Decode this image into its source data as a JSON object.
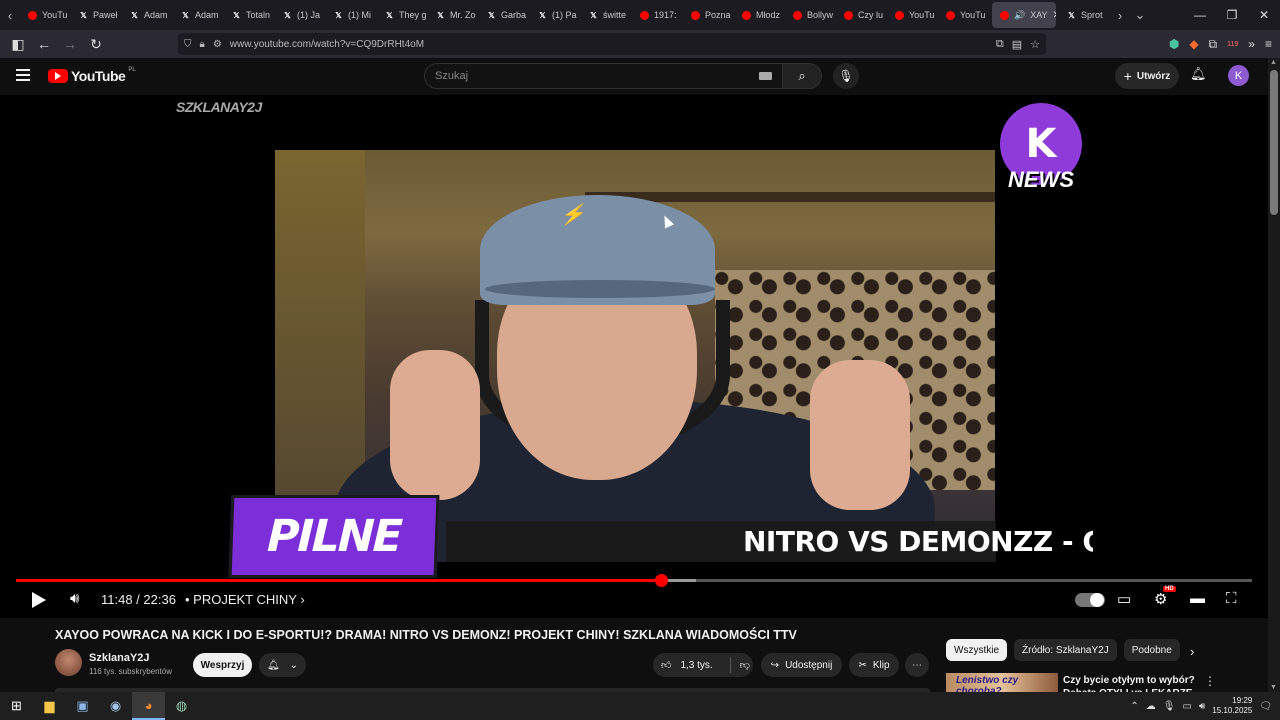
{
  "browser": {
    "tabs": [
      {
        "label": "YouTu",
        "icon": "youtube-icon"
      },
      {
        "label": "Paweł",
        "icon": "x-icon"
      },
      {
        "label": "Adam",
        "icon": "x-icon"
      },
      {
        "label": "Adam",
        "icon": "x-icon"
      },
      {
        "label": "Totaln",
        "icon": "x-icon"
      },
      {
        "label": "(1) Ja",
        "icon": "x-icon"
      },
      {
        "label": "(1) Mi",
        "icon": "x-icon"
      },
      {
        "label": "They g",
        "icon": "x-icon"
      },
      {
        "label": "Mr. Zo",
        "icon": "x-icon"
      },
      {
        "label": "Garba",
        "icon": "x-icon"
      },
      {
        "label": "(1) Pa",
        "icon": "x-icon"
      },
      {
        "label": "świtte",
        "icon": "x-icon"
      },
      {
        "label": "1917:",
        "icon": "youtube-icon"
      },
      {
        "label": "Pozna",
        "icon": "youtube-icon"
      },
      {
        "label": "Młodz",
        "icon": "youtube-icon"
      },
      {
        "label": "Bollyw",
        "icon": "youtube-icon"
      },
      {
        "label": "Czy lu",
        "icon": "youtube-icon"
      },
      {
        "label": "YouTu",
        "icon": "youtube-icon"
      },
      {
        "label": "YouTu",
        "icon": "youtube-icon"
      }
    ],
    "active_tab": {
      "label": "XAY",
      "icon": "youtube-icon",
      "audio_icon": "speaker-icon"
    },
    "trailing_tab": {
      "label": "Sprot",
      "icon": "x-icon"
    },
    "url": "www.youtube.com/watch?v=CQ9DrRHt4oM",
    "extension_badge": "119"
  },
  "youtube": {
    "logo_text": "YouTube",
    "country_code": "PL",
    "search_placeholder": "Szukaj",
    "create_label": "Utwórz",
    "avatar_letter": "K"
  },
  "player": {
    "channel_watermark": "SZKLANAY2J",
    "brand_badge": "NEWS",
    "banner_label": "PILNE",
    "ticker_text": "NITRO VS DEMONZZ - OSTR",
    "current_time": "11:48",
    "duration": "22:36",
    "time_display": "11:48 / 22:36",
    "chapter": "• PROJEKT CHINY",
    "progress_fraction": 0.522,
    "buffered_fraction": 0.55,
    "quality_badge": "HD"
  },
  "video": {
    "title": "XAYOO POWRACA NA KICK I DO E-SPORTU!? DRAMA! NITRO VS DEMONZ! PROJEKT CHINY! SZKLANA WIADOMOŚCI TTV",
    "channel_name": "SzklanaY2J",
    "subscribers": "116 tys. subskrybentów",
    "support_label": "Wesprzyj",
    "like_count": "1,3 tys.",
    "share_label": "Udostępnij",
    "clip_label": "Klip"
  },
  "sidebar": {
    "chips": [
      "Wszystkie",
      "Źródło: SzklanaY2J",
      "Podobne"
    ],
    "selected_chip": "Wszystkie",
    "recommendation": {
      "thumb_text": "Lenistwo czy choroba?",
      "title": "Czy bycie otyłym to wybór? Debata OTYLI vs LEKARZE"
    }
  },
  "taskbar": {
    "time": "19:29",
    "date": "15.10.2025"
  }
}
